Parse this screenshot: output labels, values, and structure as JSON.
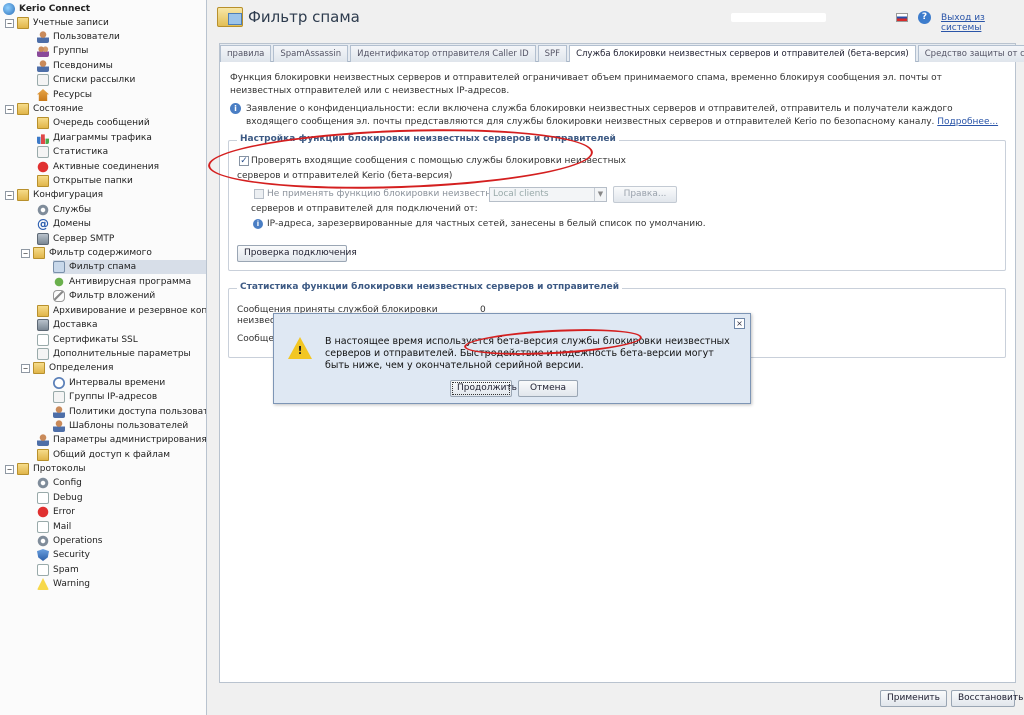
{
  "app": {
    "title": "Kerio Connect"
  },
  "sidebar": {
    "items": [
      {
        "label": "Kerio Connect",
        "icon": "app-icon"
      },
      {
        "label": "Учетные записи",
        "icon": "folder-icon"
      },
      {
        "label": "Пользователи",
        "icon": "user-icon"
      },
      {
        "label": "Группы",
        "icon": "group-icon"
      },
      {
        "label": "Псевдонимы",
        "icon": "alias-icon"
      },
      {
        "label": "Списки рассылки",
        "icon": "mailing-list-icon"
      },
      {
        "label": "Ресурсы",
        "icon": "resource-icon"
      },
      {
        "label": "Состояние",
        "icon": "folder-icon"
      },
      {
        "label": "Очередь сообщений",
        "icon": "queue-icon"
      },
      {
        "label": "Диаграммы трафика",
        "icon": "chart-icon"
      },
      {
        "label": "Статистика",
        "icon": "statistics-icon"
      },
      {
        "label": "Активные соединения",
        "icon": "connections-icon"
      },
      {
        "label": "Открытые папки",
        "icon": "open-folders-icon"
      },
      {
        "label": "Конфигурация",
        "icon": "folder-icon"
      },
      {
        "label": "Службы",
        "icon": "gear-icon"
      },
      {
        "label": "Домены",
        "icon": "at-icon"
      },
      {
        "label": "Сервер SMTP",
        "icon": "server-icon"
      },
      {
        "label": "Фильтр содержимого",
        "icon": "folder-icon"
      },
      {
        "label": "Фильтр спама",
        "icon": "spam-filter-icon"
      },
      {
        "label": "Антивирусная программа",
        "icon": "antivirus-icon"
      },
      {
        "label": "Фильтр вложений",
        "icon": "attachment-icon"
      },
      {
        "label": "Архивирование и резервное копиров",
        "icon": "archive-icon"
      },
      {
        "label": "Доставка",
        "icon": "delivery-icon"
      },
      {
        "label": "Сертификаты SSL",
        "icon": "certificate-icon"
      },
      {
        "label": "Дополнительные параметры",
        "icon": "advanced-icon"
      },
      {
        "label": "Определения",
        "icon": "folder-icon"
      },
      {
        "label": "Интервалы времени",
        "icon": "clock-icon"
      },
      {
        "label": "Группы IP-адресов",
        "icon": "ip-group-icon"
      },
      {
        "label": "Политики доступа пользователей",
        "icon": "policy-icon"
      },
      {
        "label": "Шаблоны пользователей",
        "icon": "template-icon"
      },
      {
        "label": "Параметры администрирования",
        "icon": "admin-icon"
      },
      {
        "label": "Общий доступ к файлам",
        "icon": "share-icon"
      },
      {
        "label": "Протоколы",
        "icon": "folder-icon"
      },
      {
        "label": "Config",
        "icon": "log-icon"
      },
      {
        "label": "Debug",
        "icon": "log-icon"
      },
      {
        "label": "Error",
        "icon": "error-icon"
      },
      {
        "label": "Mail",
        "icon": "log-icon"
      },
      {
        "label": "Operations",
        "icon": "log-icon"
      },
      {
        "label": "Security",
        "icon": "shield-icon"
      },
      {
        "label": "Spam",
        "icon": "log-icon"
      },
      {
        "label": "Warning",
        "icon": "warning-icon"
      }
    ]
  },
  "header": {
    "title": "Фильтр спама",
    "logout": "Выход из системы"
  },
  "tabs": [
    {
      "label": "правила"
    },
    {
      "label": "SpamAssassin"
    },
    {
      "label": "Идентификатор отправителя Caller ID"
    },
    {
      "label": "SPF"
    },
    {
      "label": "Служба блокировки неизвестных серверов и отправителей (бета-версия)"
    },
    {
      "label": "Средство защиты от спама"
    }
  ],
  "content": {
    "description": "Функция блокировки неизвестных серверов и отправителей ограничивает объем принимаемого спама, временно блокируя сообщения эл. почты от неизвестных отправителей или с неизвестных IP-адресов.",
    "privacy": "Заявление о конфиденциальности: если включена служба блокировки неизвестных серверов и отправителей, отправитель и получатели каждого входящего сообщения эл. почты представляются для службы блокировки неизвестных серверов и отправителей Kerio по безопасному каналу.",
    "privacy_link": "Подробнее...",
    "settings_legend": "Настройка функции блокировки неизвестных серверов и отправителей",
    "check_incoming_label_1": "Проверять входящие сообщения с помощью службы блокировки неизвестных",
    "check_incoming_label_2": "серверов и отправителей Kerio (бета-версия)",
    "not_apply_label_1": "Не применять функцию блокировки неизвестных",
    "not_apply_label_2": "серверов и отправителей для подключений от:",
    "ip_select": "Local clients",
    "edit_button": "Правка...",
    "ip_note": "IP-адреса, зарезервированные для частных сетей, занесены в белый список по умолчанию.",
    "test_button": "Проверка подключения",
    "stats_legend": "Статистика функции блокировки неизвестных серверов и отправителей",
    "stats_row1_label_1": "Сообщения приняты службой блокировки",
    "stats_row1_label_2": "неизвестн",
    "stats_row1_value": "0",
    "stats_row2_label": "Сообщен"
  },
  "footer": {
    "apply": "Применить",
    "reset": "Восстановить"
  },
  "dialog": {
    "message": "В настоящее время используется бета-версия службы блокировки неизвестных серверов и отправителей. Быстродействие и надежность бета-версии могут быть ниже, чем у окончательной серийной версии.",
    "continue": "Продолжить",
    "cancel": "Отмена",
    "close_glyph": "×"
  },
  "colors": {
    "accent": "#3d5a84",
    "link": "#2a55a8",
    "annotation": "#d41f1f",
    "dialog_bg": "#dfe8f3"
  }
}
